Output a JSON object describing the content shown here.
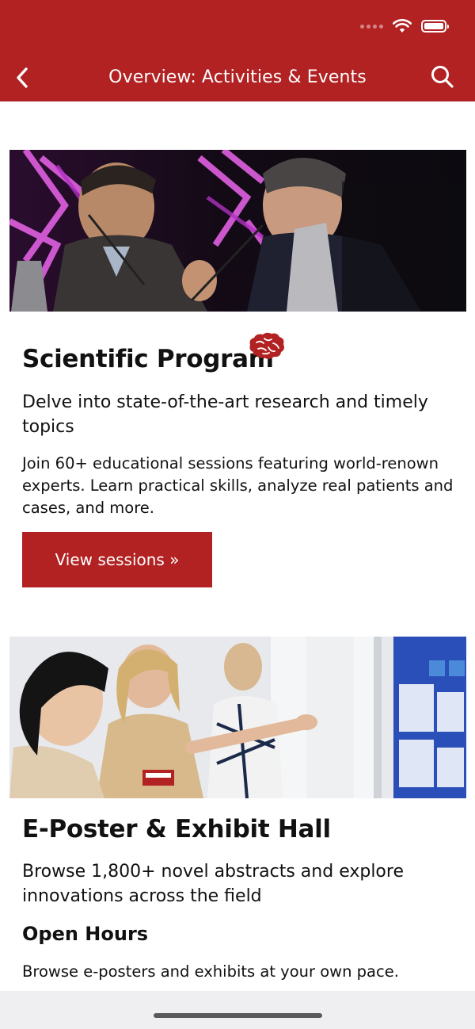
{
  "app": {
    "accent_color": "#b22222",
    "header_title": "Overview: Activities & Events"
  },
  "status_bar": {
    "icons": [
      "signal-dots-icon",
      "wifi-icon",
      "battery-icon"
    ]
  },
  "nav": {
    "back_icon": "chevron-left-icon",
    "search_icon": "search-icon"
  },
  "sections": [
    {
      "image_name": "speakers-panel-photo",
      "title": "Scientific Program",
      "icon": "brain-icon",
      "subtitle": "Delve into state-of-the-art research and timely topics",
      "description": "Join 60+ educational sessions featuring world-renown experts. Learn practical skills, analyze real patients and cases, and more.",
      "button_label": "View sessions »"
    },
    {
      "image_name": "poster-hall-photo",
      "title": "E-Poster & Exhibit Hall",
      "subtitle": "Browse 1,800+ novel abstracts and explore innovations across the field",
      "subheading": "Open Hours",
      "description": "Browse e-posters and exhibits at your own pace."
    }
  ]
}
